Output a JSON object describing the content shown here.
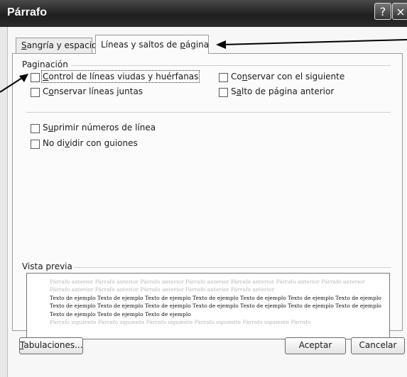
{
  "window": {
    "title": "Párrafo",
    "help_glyph": "?",
    "close_glyph": "×"
  },
  "tabs": [
    {
      "label": "Sangría y espacio",
      "hotkey": "S",
      "rest": "angría y espacio",
      "active": false
    },
    {
      "label": "Líneas y saltos de página",
      "active": true,
      "pre": "Líneas y saltos de ",
      "hotkey": "p",
      "post": "ágina"
    }
  ],
  "pagination": {
    "label": "Paginación",
    "options": [
      {
        "label": "Control de líneas viudas y huérfanas",
        "pre": "",
        "hotkey": "C",
        "post": "ontrol de líneas viudas y huérfanas",
        "checked": false
      },
      {
        "label": "Conservar con el siguiente",
        "pre": "Co",
        "hotkey": "n",
        "post": "servar con el siguiente",
        "checked": false
      },
      {
        "label": "Conservar líneas juntas",
        "pre": "C",
        "hotkey": "o",
        "post": "nservar líneas juntas",
        "checked": false
      },
      {
        "label": "Salto de página anterior",
        "pre": "S",
        "hotkey": "a",
        "post": "lto de página anterior",
        "checked": false
      }
    ]
  },
  "other_options": [
    {
      "label": "Suprimir números de línea",
      "pre": "S",
      "hotkey": "u",
      "post": "primir números de línea",
      "checked": false
    },
    {
      "label": "No dividir con guiones",
      "pre": "No di",
      "hotkey": "v",
      "post": "idir con guiones",
      "checked": false
    }
  ],
  "preview": {
    "label": "Vista previa",
    "previous_text": "Párrafo anterior Párrafo anterior Párrafo anterior Párrafo anterior Párrafo anterior Párrafo anterior Párrafo anterior Párrafo anterior Párrafo anterior Párrafo anterior Párrafo anterior Párrafo anterior",
    "sample_text": "Texto de ejemplo Texto de ejemplo Texto de ejemplo Texto de ejemplo Texto de ejemplo Texto de ejemplo Texto de ejemplo Texto de ejemplo Texto de ejemplo Texto de ejemplo Texto de ejemplo Texto de ejemplo Texto de ejemplo Texto de ejemplo Texto de ejemplo Texto de ejemplo Texto de ejemplo",
    "next_text": "Párrafo siguiente Párrafo siguiente Párrafo siguiente Párrafo siguiente Párrafo siguiente Párrafo"
  },
  "buttons": {
    "tabs_button": {
      "label": "Tabulaciones...",
      "hotkey": "T",
      "rest": "abulaciones..."
    },
    "ok_button": "Aceptar",
    "cancel_button": "Cancelar"
  },
  "colors": {
    "titlebar": "#2a2a2a",
    "dialog_bg": "#f7f7f7",
    "arrow": "#000000"
  }
}
